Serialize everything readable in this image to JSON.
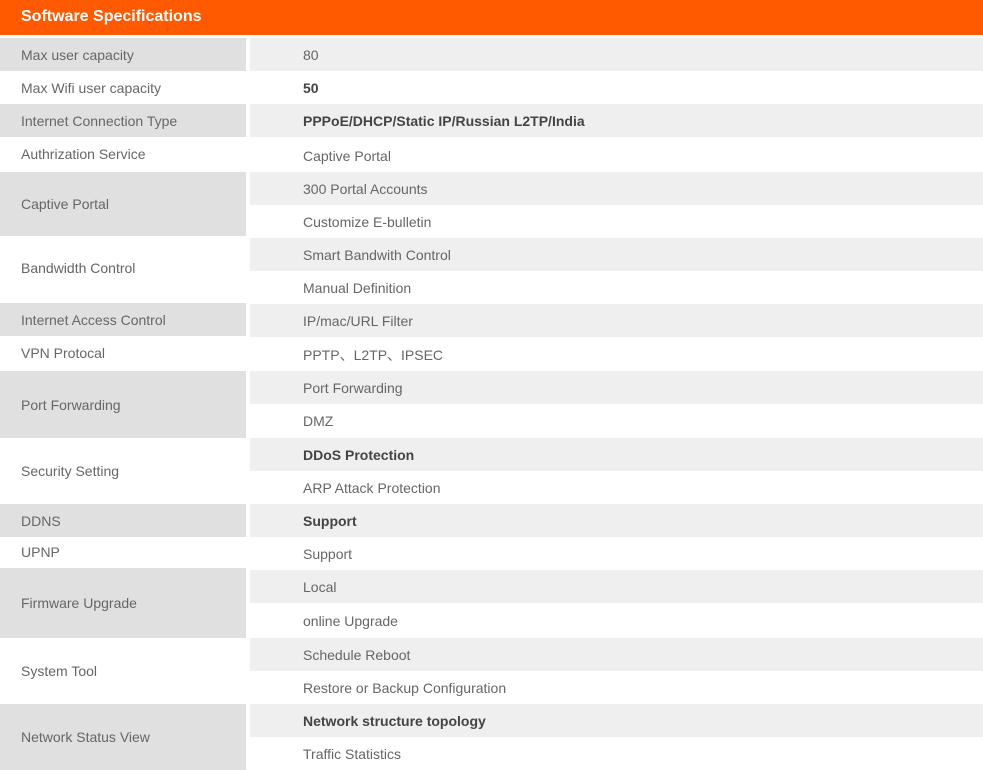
{
  "header": {
    "title": "Software Specifications"
  },
  "rows": [
    {
      "label": "Max user capacity",
      "values": [
        "80"
      ]
    },
    {
      "label": "Max Wifi user capacity",
      "values": [
        "50"
      ]
    },
    {
      "label": "Internet Connection Type",
      "values": [
        "PPPoE/DHCP/Static IP/Russian L2TP/India"
      ]
    },
    {
      "label": "Authrization Service",
      "values": [
        "Captive Portal"
      ]
    },
    {
      "label": "Captive Portal",
      "values": [
        "300 Portal Accounts",
        "Customize E-bulletin"
      ]
    },
    {
      "label": "Bandwidth Control",
      "values": [
        "Smart Bandwith Control",
        "Manual Definition"
      ]
    },
    {
      "label": "Internet Access Control",
      "values": [
        "IP/mac/URL Filter"
      ]
    },
    {
      "label": "VPN Protocal",
      "values": [
        "PPTP、L2TP、IPSEC"
      ]
    },
    {
      "label": "Port Forwarding",
      "values": [
        "Port Forwarding",
        "DMZ"
      ]
    },
    {
      "label": "Security Setting",
      "values": [
        "DDoS Protection",
        "ARP Attack Protection"
      ]
    },
    {
      "label": "DDNS",
      "values": [
        "Support"
      ]
    },
    {
      "label": "UPNP",
      "values": [
        "Support"
      ]
    },
    {
      "label": "Firmware Upgrade",
      "values": [
        "Local",
        "online Upgrade"
      ]
    },
    {
      "label": "System Tool",
      "values": [
        "Schedule Reboot",
        "Restore or Backup Configuration"
      ]
    },
    {
      "label": "Network Status View",
      "values": [
        "Network structure topology",
        "Traffic Statistics"
      ]
    }
  ],
  "colors": {
    "header_bg": "#ff5a00",
    "label_bg_alt": "#e0e0e0",
    "value_bg_alt": "#efefef",
    "text": "#666666"
  }
}
